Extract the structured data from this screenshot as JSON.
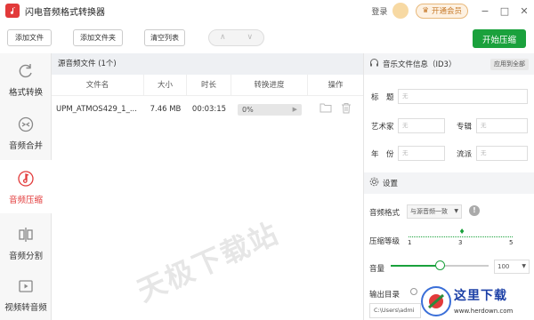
{
  "app": {
    "title": "闪电音频格式转换器"
  },
  "titlebar": {
    "login": "登录",
    "vip": "开通会员",
    "minimize": "−",
    "maximize": "□",
    "close": "✕"
  },
  "toolbar": {
    "add_file": "添加文件",
    "add_folder": "添加文件夹",
    "clear_list": "清空列表",
    "nav_prev": "∧",
    "nav_next": "∨",
    "start": "开始压缩"
  },
  "sidebar": {
    "items": [
      {
        "label": "格式转换",
        "icon": "refresh-icon",
        "active": false
      },
      {
        "label": "音频合并",
        "icon": "merge-icon",
        "active": false
      },
      {
        "label": "音频压缩",
        "icon": "music-note-icon",
        "active": true
      },
      {
        "label": "音频分割",
        "icon": "split-icon",
        "active": false
      },
      {
        "label": "视频转音频",
        "icon": "video-icon",
        "active": false
      }
    ]
  },
  "filelist": {
    "header": "源音频文件 (1个)",
    "columns": [
      "文件名",
      "大小",
      "时长",
      "转换进度",
      "操作"
    ],
    "rows": [
      {
        "name": "UPM_ATMOS429_1_...",
        "size": "7.46 MB",
        "duration": "00:03:15",
        "progress": "0%",
        "progress_value": 0
      }
    ],
    "watermark": "天极下载站"
  },
  "id3": {
    "title": "音乐文件信息（ID3）",
    "apply_all": "应用到全部",
    "fields": {
      "title_label": "标　题",
      "artist_label": "艺术家",
      "album_label": "专辑",
      "year_label": "年　份",
      "genre_label": "流派",
      "placeholder": "无"
    }
  },
  "settings": {
    "title": "设置",
    "format_label": "音频格式",
    "format_value": "与源音频一致",
    "level_label": "压缩等级",
    "level_ticks": [
      "1",
      "3",
      "5"
    ],
    "level_value": 3,
    "volume_label": "音量",
    "volume_value": "100",
    "volume_fraction": 0.5,
    "output_label": "输出目录",
    "output_path": "C:\\Users\\admi"
  },
  "brand": {
    "text": "这里下载",
    "url_text": "www.herdown.com"
  },
  "colors": {
    "accent": "#1aa13c",
    "active": "#e23a3a",
    "vip": "#c77a2a"
  }
}
